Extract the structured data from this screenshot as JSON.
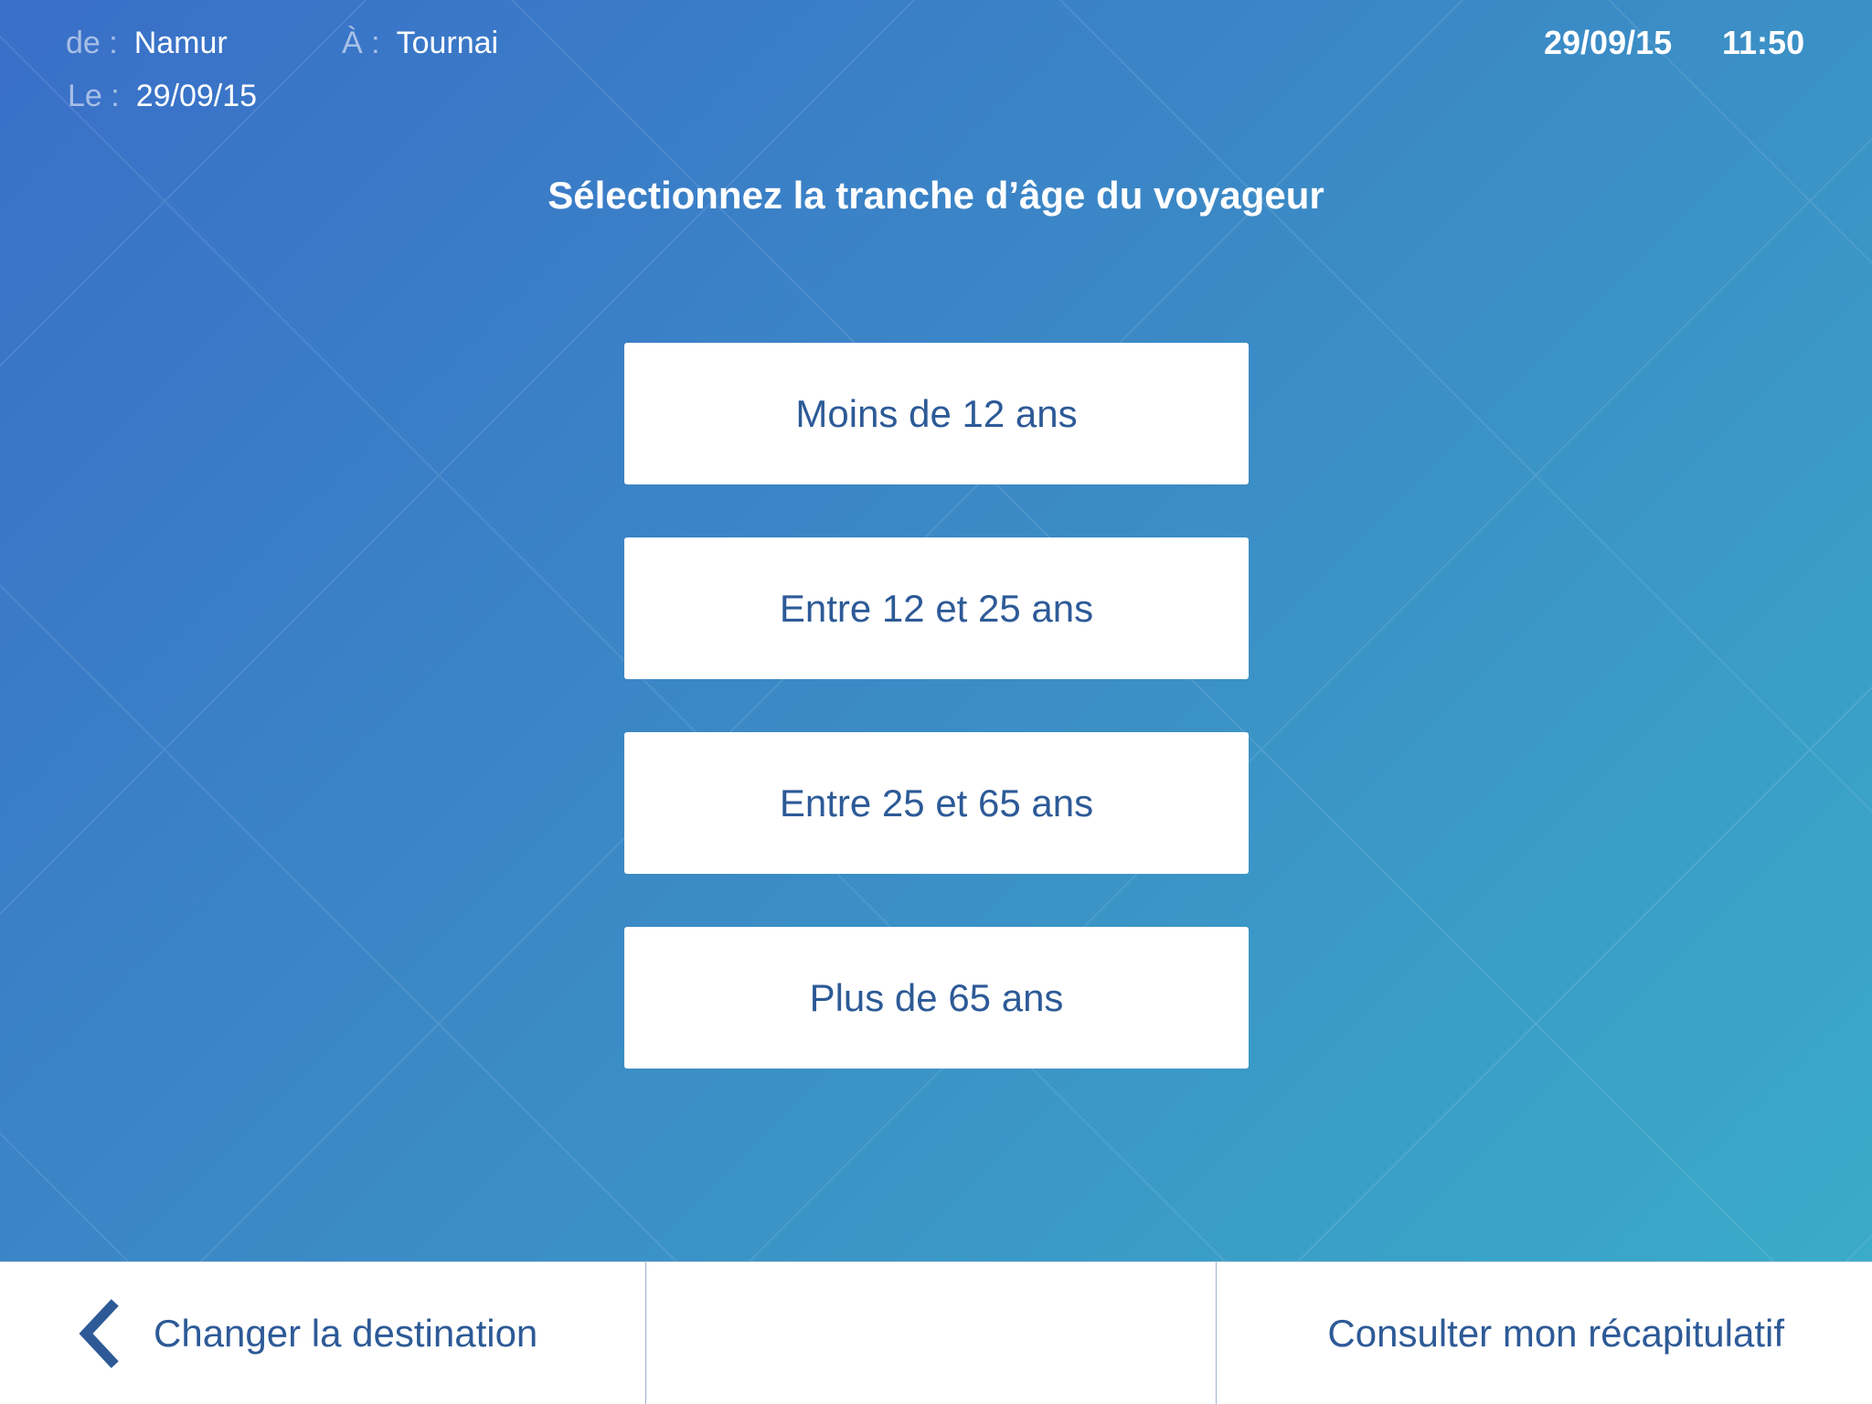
{
  "trip": {
    "from_label": "de :",
    "from_value": "Namur",
    "to_label": "À :",
    "to_value": "Tournai",
    "on_label": "Le :",
    "on_value": "29/09/15"
  },
  "clock": {
    "date": "29/09/15",
    "time": "11:50"
  },
  "question": "Sélectionnez la tranche d’âge du voyageur",
  "options": [
    {
      "label": "Moins de 12 ans"
    },
    {
      "label": "Entre 12 et 25 ans"
    },
    {
      "label": "Entre 25 et 65 ans"
    },
    {
      "label": "Plus de 65 ans"
    }
  ],
  "bottom_bar": {
    "back_label": "Changer la destination",
    "back_icon": "chevron-left-icon",
    "summary_label": "Consulter mon récapitulatif"
  },
  "colors": {
    "gradient_start": "#3a6fc8",
    "gradient_end": "#3aaec8",
    "button_text": "#2d5a97",
    "button_bg": "#ffffff"
  }
}
